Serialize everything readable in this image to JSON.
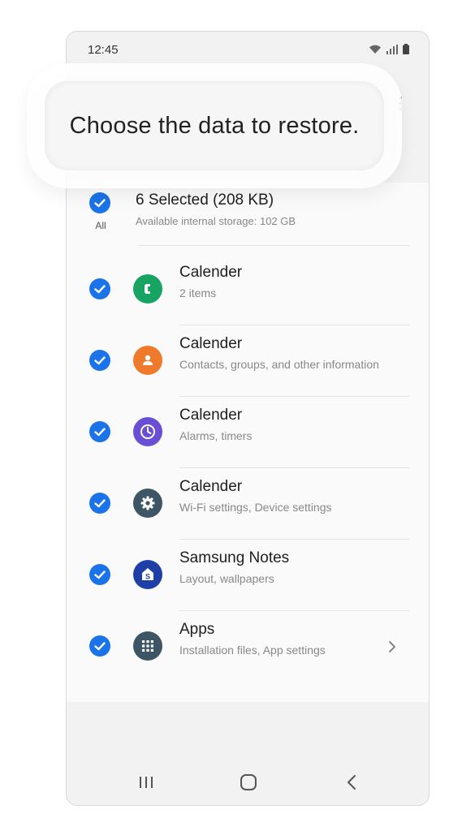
{
  "status": {
    "time": "12:45"
  },
  "tooltip": {
    "text": "Choose the data to restore."
  },
  "select_all": {
    "title": "6 Selected (208 KB)",
    "subtitle": "Available internal storage: 102 GB",
    "all_label": "All",
    "checked": true
  },
  "items": [
    {
      "title": "Calender",
      "subtitle": "2 items",
      "icon": "phone-icon",
      "color": "#17a362",
      "checked": true
    },
    {
      "title": "Calender",
      "subtitle": "Contacts, groups, and other information",
      "icon": "contacts-icon",
      "color": "#f07a2b",
      "checked": true
    },
    {
      "title": "Calender",
      "subtitle": "Alarms, timers",
      "icon": "clock-icon",
      "color": "#6a4fd6",
      "checked": true
    },
    {
      "title": "Calender",
      "subtitle": "Wi-Fi settings, Device settings",
      "icon": "gear-icon",
      "color": "#3e5566",
      "checked": true
    },
    {
      "title": "Samsung Notes",
      "subtitle": "Layout, wallpapers",
      "icon": "samsung-notes-icon",
      "color": "#1f3ea8",
      "checked": true
    },
    {
      "title": "Apps",
      "subtitle": "Installation files, App settings",
      "icon": "apps-grid-icon",
      "color": "#3e5566",
      "checked": true,
      "has_chevron": true
    }
  ],
  "colors": {
    "accent": "#1a73e8"
  }
}
